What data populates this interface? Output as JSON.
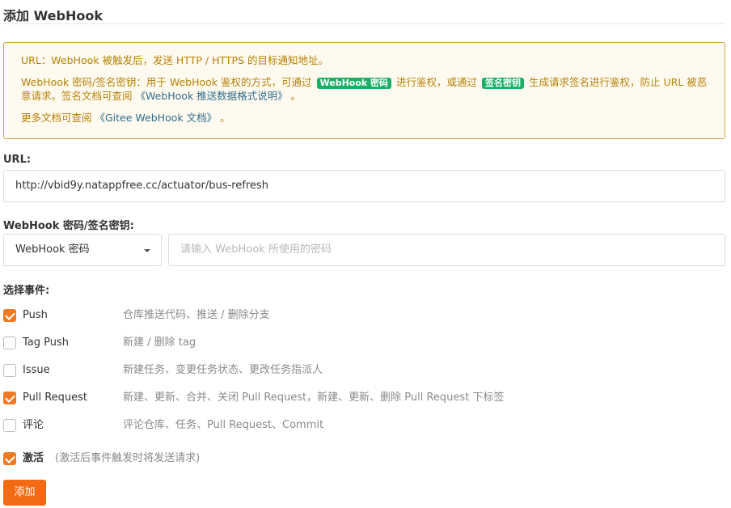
{
  "page": {
    "title": "添加 WebHook"
  },
  "notice": {
    "line1": "URL：WebHook 被触发后，发送 HTTP / HTTPS 的目标通知地址。",
    "line2_part1": "WebHook 密码/签名密钥：用于 WebHook 鉴权的方式，可通过",
    "tag_password": "WebHook 密码",
    "line2_part2": "进行鉴权，或通过",
    "tag_signature": "签名密钥",
    "line2_part3": "生成请求签名进行鉴权，防止 URL 被恶意请求。签名文档可查阅",
    "link_push_format": "《WebHook 推送数据格式说明》",
    "line2_end": "。",
    "line3_part1": "更多文档可查阅",
    "link_gitee_docs": "《Gitee WebHook 文档》",
    "line3_end": "。"
  },
  "form": {
    "url_label": "URL:",
    "url_value": "http://vbid9y.natappfree.cc/actuator/bus-refresh",
    "secret_label": "WebHook 密码/签名密钥:",
    "secret_type_selected": "WebHook 密码",
    "secret_placeholder": "请输入 WebHook 所使用的密码",
    "events_label": "选择事件:",
    "events": [
      {
        "name": "Push",
        "description": "仓库推送代码、推送 / 删除分支",
        "checked": true
      },
      {
        "name": "Tag Push",
        "description": "新建 / 删除 tag",
        "checked": false
      },
      {
        "name": "Issue",
        "description": "新建任务、变更任务状态、更改任务指派人",
        "checked": false
      },
      {
        "name": "Pull Request",
        "description": "新建、更新、合并、关闭 Pull Request，新建、更新、删除 Pull Request 下标签",
        "checked": true
      },
      {
        "name": "评论",
        "description": "评论仓库、任务、Pull Request、Commit",
        "checked": false
      }
    ],
    "activate_label": "激活",
    "activate_hint": "(激活后事件触发时将发送请求)",
    "activate_checked": true,
    "submit_label": "添加"
  },
  "colors": {
    "accent": "#f26a14",
    "checkbox_on": "#f07a22",
    "notice_bg": "#fffaf0",
    "notice_border": "#c9a441",
    "notice_text": "#b58105",
    "tag_green": "#1cae65",
    "link": "#2e6c8d"
  },
  "icons": {
    "select_caret": "caret-down-icon",
    "checkbox_checked": "checkmark-icon"
  }
}
